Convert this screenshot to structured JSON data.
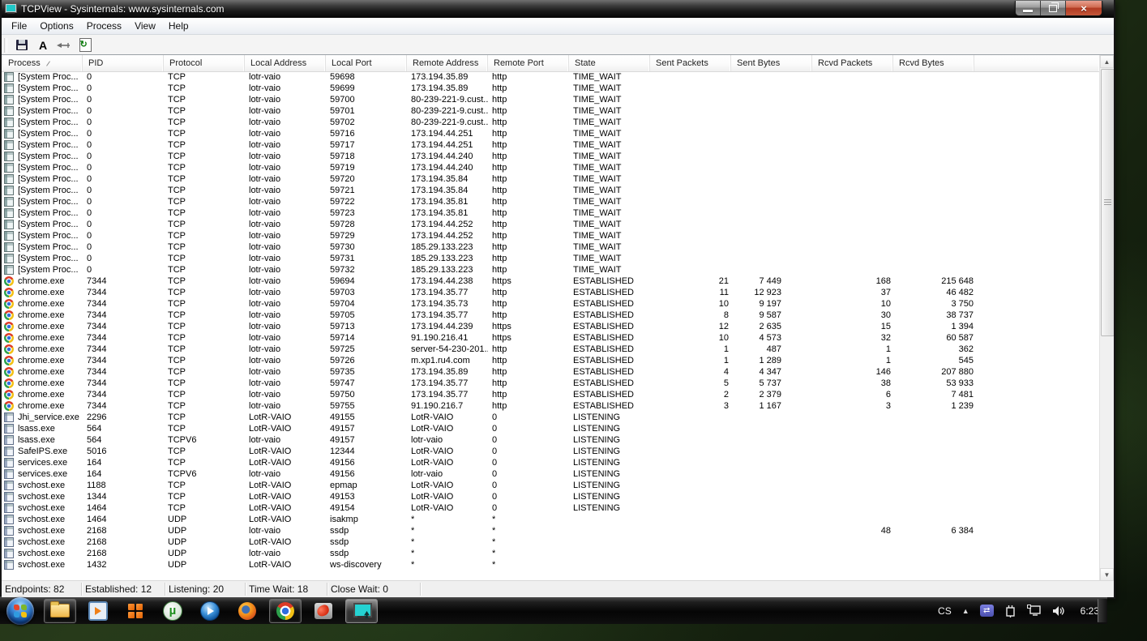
{
  "window": {
    "title": "TCPView - Sysinternals: www.sysinternals.com",
    "menu": [
      {
        "label": "File"
      },
      {
        "label": "Options"
      },
      {
        "label": "Process"
      },
      {
        "label": "View"
      },
      {
        "label": "Help"
      }
    ],
    "toolbar_buttons": [
      "save",
      "font",
      "close-connection",
      "refresh"
    ]
  },
  "table": {
    "columns": [
      "Process",
      "PID",
      "Protocol",
      "Local Address",
      "Local Port",
      "Remote Address",
      "Remote Port",
      "State",
      "Sent Packets",
      "Sent Bytes",
      "Rcvd Packets",
      "Rcvd Bytes"
    ],
    "rows": [
      {
        "icon": "sys",
        "cells": [
          "[System Proc...",
          "0",
          "TCP",
          "lotr-vaio",
          "59698",
          "173.194.35.89",
          "http",
          "TIME_WAIT",
          "",
          "",
          "",
          ""
        ]
      },
      {
        "icon": "sys",
        "cells": [
          "[System Proc...",
          "0",
          "TCP",
          "lotr-vaio",
          "59699",
          "173.194.35.89",
          "http",
          "TIME_WAIT",
          "",
          "",
          "",
          ""
        ]
      },
      {
        "icon": "sys",
        "cells": [
          "[System Proc...",
          "0",
          "TCP",
          "lotr-vaio",
          "59700",
          "80-239-221-9.cust...",
          "http",
          "TIME_WAIT",
          "",
          "",
          "",
          ""
        ]
      },
      {
        "icon": "sys",
        "cells": [
          "[System Proc...",
          "0",
          "TCP",
          "lotr-vaio",
          "59701",
          "80-239-221-9.cust...",
          "http",
          "TIME_WAIT",
          "",
          "",
          "",
          ""
        ]
      },
      {
        "icon": "sys",
        "cells": [
          "[System Proc...",
          "0",
          "TCP",
          "lotr-vaio",
          "59702",
          "80-239-221-9.cust...",
          "http",
          "TIME_WAIT",
          "",
          "",
          "",
          ""
        ]
      },
      {
        "icon": "sys",
        "cells": [
          "[System Proc...",
          "0",
          "TCP",
          "lotr-vaio",
          "59716",
          "173.194.44.251",
          "http",
          "TIME_WAIT",
          "",
          "",
          "",
          ""
        ]
      },
      {
        "icon": "sys",
        "cells": [
          "[System Proc...",
          "0",
          "TCP",
          "lotr-vaio",
          "59717",
          "173.194.44.251",
          "http",
          "TIME_WAIT",
          "",
          "",
          "",
          ""
        ]
      },
      {
        "icon": "sys",
        "cells": [
          "[System Proc...",
          "0",
          "TCP",
          "lotr-vaio",
          "59718",
          "173.194.44.240",
          "http",
          "TIME_WAIT",
          "",
          "",
          "",
          ""
        ]
      },
      {
        "icon": "sys",
        "cells": [
          "[System Proc...",
          "0",
          "TCP",
          "lotr-vaio",
          "59719",
          "173.194.44.240",
          "http",
          "TIME_WAIT",
          "",
          "",
          "",
          ""
        ]
      },
      {
        "icon": "sys",
        "cells": [
          "[System Proc...",
          "0",
          "TCP",
          "lotr-vaio",
          "59720",
          "173.194.35.84",
          "http",
          "TIME_WAIT",
          "",
          "",
          "",
          ""
        ]
      },
      {
        "icon": "sys",
        "cells": [
          "[System Proc...",
          "0",
          "TCP",
          "lotr-vaio",
          "59721",
          "173.194.35.84",
          "http",
          "TIME_WAIT",
          "",
          "",
          "",
          ""
        ]
      },
      {
        "icon": "sys",
        "cells": [
          "[System Proc...",
          "0",
          "TCP",
          "lotr-vaio",
          "59722",
          "173.194.35.81",
          "http",
          "TIME_WAIT",
          "",
          "",
          "",
          ""
        ]
      },
      {
        "icon": "sys",
        "cells": [
          "[System Proc...",
          "0",
          "TCP",
          "lotr-vaio",
          "59723",
          "173.194.35.81",
          "http",
          "TIME_WAIT",
          "",
          "",
          "",
          ""
        ]
      },
      {
        "icon": "sys",
        "cells": [
          "[System Proc...",
          "0",
          "TCP",
          "lotr-vaio",
          "59728",
          "173.194.44.252",
          "http",
          "TIME_WAIT",
          "",
          "",
          "",
          ""
        ]
      },
      {
        "icon": "sys",
        "cells": [
          "[System Proc...",
          "0",
          "TCP",
          "lotr-vaio",
          "59729",
          "173.194.44.252",
          "http",
          "TIME_WAIT",
          "",
          "",
          "",
          ""
        ]
      },
      {
        "icon": "sys",
        "cells": [
          "[System Proc...",
          "0",
          "TCP",
          "lotr-vaio",
          "59730",
          "185.29.133.223",
          "http",
          "TIME_WAIT",
          "",
          "",
          "",
          ""
        ]
      },
      {
        "icon": "sys",
        "cells": [
          "[System Proc...",
          "0",
          "TCP",
          "lotr-vaio",
          "59731",
          "185.29.133.223",
          "http",
          "TIME_WAIT",
          "",
          "",
          "",
          ""
        ]
      },
      {
        "icon": "sys",
        "cells": [
          "[System Proc...",
          "0",
          "TCP",
          "lotr-vaio",
          "59732",
          "185.29.133.223",
          "http",
          "TIME_WAIT",
          "",
          "",
          "",
          ""
        ]
      },
      {
        "icon": "chrome",
        "cells": [
          "chrome.exe",
          "7344",
          "TCP",
          "lotr-vaio",
          "59694",
          "173.194.44.238",
          "https",
          "ESTABLISHED",
          "21",
          "7 449",
          "168",
          "215 648"
        ]
      },
      {
        "icon": "chrome",
        "cells": [
          "chrome.exe",
          "7344",
          "TCP",
          "lotr-vaio",
          "59703",
          "173.194.35.77",
          "http",
          "ESTABLISHED",
          "11",
          "12 923",
          "37",
          "46 482"
        ]
      },
      {
        "icon": "chrome",
        "cells": [
          "chrome.exe",
          "7344",
          "TCP",
          "lotr-vaio",
          "59704",
          "173.194.35.73",
          "http",
          "ESTABLISHED",
          "10",
          "9 197",
          "10",
          "3 750"
        ]
      },
      {
        "icon": "chrome",
        "cells": [
          "chrome.exe",
          "7344",
          "TCP",
          "lotr-vaio",
          "59705",
          "173.194.35.77",
          "http",
          "ESTABLISHED",
          "8",
          "9 587",
          "30",
          "38 737"
        ]
      },
      {
        "icon": "chrome",
        "cells": [
          "chrome.exe",
          "7344",
          "TCP",
          "lotr-vaio",
          "59713",
          "173.194.44.239",
          "https",
          "ESTABLISHED",
          "12",
          "2 635",
          "15",
          "1 394"
        ]
      },
      {
        "icon": "chrome",
        "cells": [
          "chrome.exe",
          "7344",
          "TCP",
          "lotr-vaio",
          "59714",
          "91.190.216.41",
          "https",
          "ESTABLISHED",
          "10",
          "4 573",
          "32",
          "60 587"
        ]
      },
      {
        "icon": "chrome",
        "cells": [
          "chrome.exe",
          "7344",
          "TCP",
          "lotr-vaio",
          "59725",
          "server-54-230-201...",
          "http",
          "ESTABLISHED",
          "1",
          "487",
          "1",
          "362"
        ]
      },
      {
        "icon": "chrome",
        "cells": [
          "chrome.exe",
          "7344",
          "TCP",
          "lotr-vaio",
          "59726",
          "m.xp1.ru4.com",
          "http",
          "ESTABLISHED",
          "1",
          "1 289",
          "1",
          "545"
        ]
      },
      {
        "icon": "chrome",
        "cells": [
          "chrome.exe",
          "7344",
          "TCP",
          "lotr-vaio",
          "59735",
          "173.194.35.89",
          "http",
          "ESTABLISHED",
          "4",
          "4 347",
          "146",
          "207 880"
        ]
      },
      {
        "icon": "chrome",
        "cells": [
          "chrome.exe",
          "7344",
          "TCP",
          "lotr-vaio",
          "59747",
          "173.194.35.77",
          "http",
          "ESTABLISHED",
          "5",
          "5 737",
          "38",
          "53 933"
        ]
      },
      {
        "icon": "chrome",
        "cells": [
          "chrome.exe",
          "7344",
          "TCP",
          "lotr-vaio",
          "59750",
          "173.194.35.77",
          "http",
          "ESTABLISHED",
          "2",
          "2 379",
          "6",
          "7 481"
        ]
      },
      {
        "icon": "chrome",
        "cells": [
          "chrome.exe",
          "7344",
          "TCP",
          "lotr-vaio",
          "59755",
          "91.190.216.7",
          "http",
          "ESTABLISHED",
          "3",
          "1 167",
          "3",
          "1 239"
        ]
      },
      {
        "icon": "svc",
        "cells": [
          "Jhi_service.exe",
          "2296",
          "TCP",
          "LotR-VAIO",
          "49155",
          "LotR-VAIO",
          "0",
          "LISTENING",
          "",
          "",
          "",
          ""
        ]
      },
      {
        "icon": "svc",
        "cells": [
          "lsass.exe",
          "564",
          "TCP",
          "LotR-VAIO",
          "49157",
          "LotR-VAIO",
          "0",
          "LISTENING",
          "",
          "",
          "",
          ""
        ]
      },
      {
        "icon": "svc",
        "cells": [
          "lsass.exe",
          "564",
          "TCPV6",
          "lotr-vaio",
          "49157",
          "lotr-vaio",
          "0",
          "LISTENING",
          "",
          "",
          "",
          ""
        ]
      },
      {
        "icon": "svc",
        "cells": [
          "SafeIPS.exe",
          "5016",
          "TCP",
          "LotR-VAIO",
          "12344",
          "LotR-VAIO",
          "0",
          "LISTENING",
          "",
          "",
          "",
          ""
        ]
      },
      {
        "icon": "svc",
        "cells": [
          "services.exe",
          "164",
          "TCP",
          "LotR-VAIO",
          "49156",
          "LotR-VAIO",
          "0",
          "LISTENING",
          "",
          "",
          "",
          ""
        ]
      },
      {
        "icon": "svc",
        "cells": [
          "services.exe",
          "164",
          "TCPV6",
          "lotr-vaio",
          "49156",
          "lotr-vaio",
          "0",
          "LISTENING",
          "",
          "",
          "",
          ""
        ]
      },
      {
        "icon": "svc",
        "cells": [
          "svchost.exe",
          "1188",
          "TCP",
          "LotR-VAIO",
          "epmap",
          "LotR-VAIO",
          "0",
          "LISTENING",
          "",
          "",
          "",
          ""
        ]
      },
      {
        "icon": "svc",
        "cells": [
          "svchost.exe",
          "1344",
          "TCP",
          "LotR-VAIO",
          "49153",
          "LotR-VAIO",
          "0",
          "LISTENING",
          "",
          "",
          "",
          ""
        ]
      },
      {
        "icon": "svc",
        "cells": [
          "svchost.exe",
          "1464",
          "TCP",
          "LotR-VAIO",
          "49154",
          "LotR-VAIO",
          "0",
          "LISTENING",
          "",
          "",
          "",
          ""
        ]
      },
      {
        "icon": "svc",
        "cells": [
          "svchost.exe",
          "1464",
          "UDP",
          "LotR-VAIO",
          "isakmp",
          "*",
          "*",
          "",
          "",
          "",
          "",
          ""
        ]
      },
      {
        "icon": "svc",
        "cells": [
          "svchost.exe",
          "2168",
          "UDP",
          "lotr-vaio",
          "ssdp",
          "*",
          "*",
          "",
          "",
          "",
          "48",
          "6 384"
        ]
      },
      {
        "icon": "svc",
        "cells": [
          "svchost.exe",
          "2168",
          "UDP",
          "LotR-VAIO",
          "ssdp",
          "*",
          "*",
          "",
          "",
          "",
          "",
          ""
        ]
      },
      {
        "icon": "svc",
        "cells": [
          "svchost.exe",
          "2168",
          "UDP",
          "lotr-vaio",
          "ssdp",
          "*",
          "*",
          "",
          "",
          "",
          "",
          ""
        ]
      },
      {
        "icon": "svc",
        "cells": [
          "svchost.exe",
          "1432",
          "UDP",
          "LotR-VAIO",
          "ws-discovery",
          "*",
          "*",
          "",
          "",
          "",
          "",
          ""
        ]
      }
    ]
  },
  "statusbar": {
    "items": [
      "Endpoints: 82",
      "Established: 12",
      "Listening: 20",
      "Time Wait: 18",
      "Close Wait: 0"
    ]
  },
  "taskbar": {
    "apps": [
      "start",
      "windows-explorer",
      "media-player-classic",
      "ms-office",
      "utorrent",
      "windows-media-player",
      "firefox",
      "chrome",
      "red-app",
      "tcpview"
    ],
    "tray": {
      "language": "CS",
      "hidden_icons_arrow": "▲",
      "sync_glyph": "⇄",
      "time": "6:23"
    }
  }
}
